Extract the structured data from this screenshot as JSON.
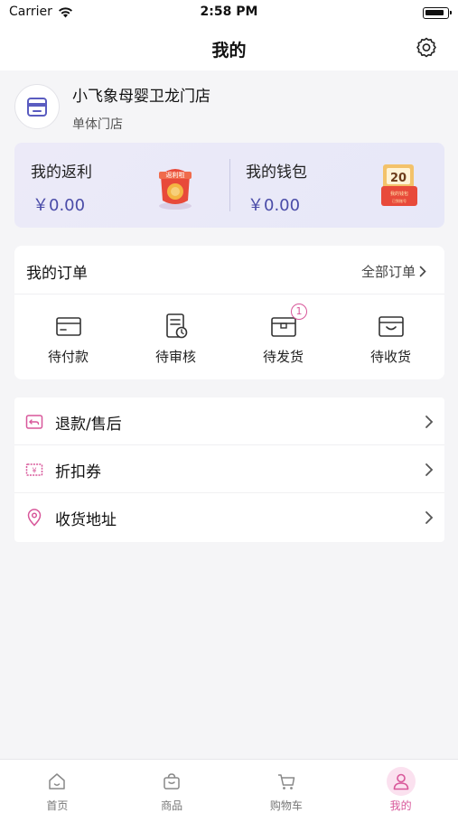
{
  "status_bar": {
    "carrier": "Carrier",
    "time": "2:58 PM"
  },
  "nav": {
    "title": "我的",
    "settings_icon": "gear-icon"
  },
  "store": {
    "name": "小飞象母婴卫龙门店",
    "type": "单体门店",
    "icon": "store-icon"
  },
  "wallet": {
    "rebate": {
      "label": "我的返利",
      "amount": "￥0.00",
      "art_text": "返利啦"
    },
    "purse": {
      "label": "我的钱包",
      "amount": "￥0.00",
      "art_number": "20",
      "art_text": "我的钱包",
      "art_sub": "已到账号"
    }
  },
  "orders": {
    "title": "我的订单",
    "all_label": "全部订单",
    "items": [
      {
        "label": "待付款",
        "icon": "card-icon"
      },
      {
        "label": "待审核",
        "icon": "audit-icon"
      },
      {
        "label": "待发货",
        "icon": "box-icon",
        "badge": "1"
      },
      {
        "label": "待收货",
        "icon": "bag-icon"
      }
    ]
  },
  "menu": [
    {
      "label": "退款/售后",
      "icon": "refund-icon"
    },
    {
      "label": "折扣券",
      "icon": "coupon-icon"
    },
    {
      "label": "收货地址",
      "icon": "location-icon"
    }
  ],
  "tabbar": [
    {
      "label": "首页",
      "icon": "home-icon",
      "active": false
    },
    {
      "label": "商品",
      "icon": "goods-icon",
      "active": false
    },
    {
      "label": "购物车",
      "icon": "cart-icon",
      "active": false
    },
    {
      "label": "我的",
      "icon": "user-icon",
      "active": true
    }
  ],
  "colors": {
    "accent": "#d8579a",
    "amount": "#4a4ca8",
    "wallet_bg": "#eceaf8"
  }
}
